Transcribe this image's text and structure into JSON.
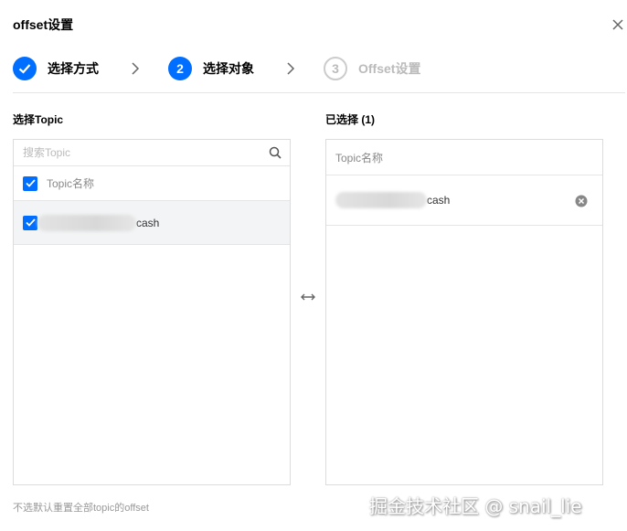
{
  "dialog": {
    "title": "offset设置"
  },
  "steps": [
    {
      "number": "",
      "label": "选择方式",
      "state": "done"
    },
    {
      "number": "2",
      "label": "选择对象",
      "state": "active"
    },
    {
      "number": "3",
      "label": "Offset设置",
      "state": "pending"
    }
  ],
  "left": {
    "section_label": "选择Topic",
    "search_placeholder": "搜索Topic",
    "column_header": "Topic名称",
    "rows": [
      {
        "name_suffix": "cash",
        "checked": true
      }
    ]
  },
  "right": {
    "section_label": "已选择 (1)",
    "column_header": "Topic名称",
    "rows": [
      {
        "name_suffix": "cash"
      }
    ]
  },
  "footer": {
    "note": "不选默认重置全部topic的offset"
  },
  "watermark": "掘金技术社区 @ snail_lie",
  "colors": {
    "accent": "#006eff",
    "pending": "#bbbbbb",
    "border": "#dcdcdc",
    "row_selected": "#f2f4f5"
  }
}
